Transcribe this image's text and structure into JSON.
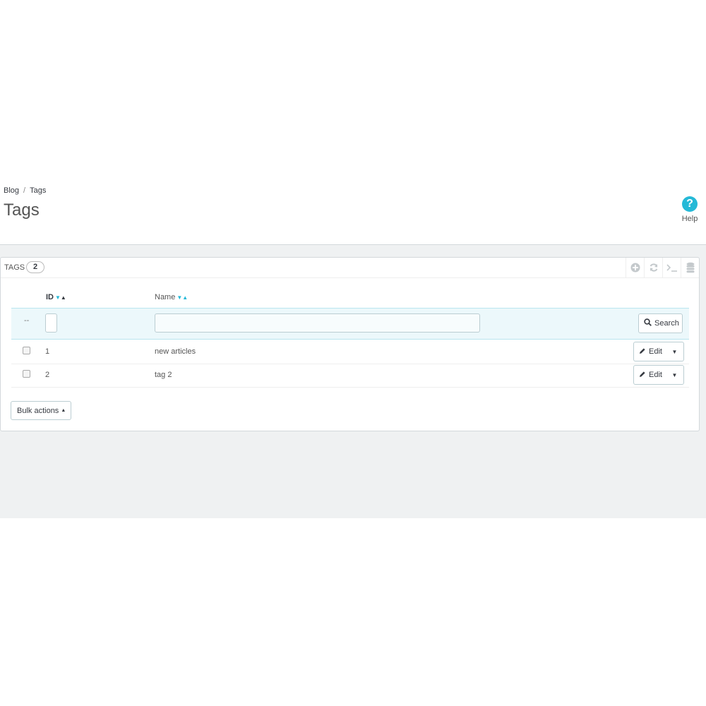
{
  "breadcrumb": {
    "parent": "Blog",
    "separator": "/",
    "current": "Tags"
  },
  "page_title": "Tags",
  "help": {
    "label": "Help",
    "glyph": "?"
  },
  "panel": {
    "title": "Tags",
    "count": "2",
    "toolbar_icons": [
      "add-icon",
      "refresh-icon",
      "sql-query-icon",
      "database-export-icon"
    ]
  },
  "table": {
    "columns": [
      {
        "label": "ID",
        "sort_desc": "▼",
        "sort_asc": "▲"
      },
      {
        "label": "Name",
        "sort_desc": "▼",
        "sort_asc": "▲"
      }
    ],
    "filter": {
      "checkbox_placeholder": "--",
      "id_value": "",
      "name_value": "",
      "search_label": "Search"
    },
    "rows": [
      {
        "id": "1",
        "name": "new articles",
        "action": "Edit"
      },
      {
        "id": "2",
        "name": "tag 2",
        "action": "Edit"
      }
    ]
  },
  "bulk_actions": "Bulk actions",
  "colors": {
    "accent": "#25b9d7",
    "background": "#eff1f2",
    "border": "#bbcdd2"
  }
}
